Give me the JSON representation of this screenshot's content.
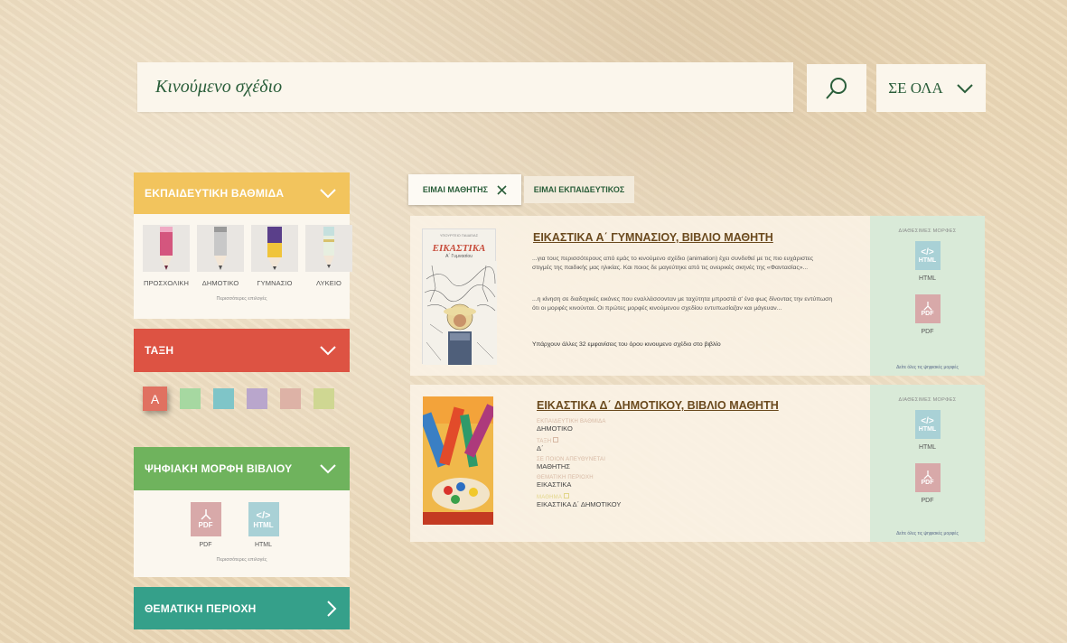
{
  "search": {
    "value": "Κινούμενο σχέδιο",
    "scope_label": "ΣΕ ΟΛΑ"
  },
  "colors": {
    "green_text": "#2a5e3a",
    "yellow": "#f2c45d",
    "red": "#dd5343",
    "green": "#6fb35d",
    "teal": "#35a08a"
  },
  "panels": {
    "education": {
      "title": "ΕΚΠΑΙΔΕΥΤΙΚΗ ΒΑΘΜΙΔΑ",
      "items": [
        {
          "label": "ΠΡΟΣΧΟΛΙΚΗ",
          "icon": "pink-pencil-icon"
        },
        {
          "label": "ΔΗΜΟΤΙΚΟ",
          "icon": "grey-pencil-icon"
        },
        {
          "label": "ΓΥΜΝΑΣΙΟ",
          "icon": "yellow-pencil-icon"
        },
        {
          "label": "ΛΥΚΕΙΟ",
          "icon": "light-pencil-icon"
        }
      ],
      "more": "Περισσότερες επιλογές"
    },
    "class": {
      "title": "ΤΑΞΗ",
      "first_label": "A",
      "swatches": [
        "#a6d8a1",
        "#7fc5c8",
        "#b9a6cc",
        "#ddb2a6",
        "#cfd792"
      ]
    },
    "digital": {
      "title": "ΨΗΦΙΑΚΗ ΜΟΡΦΗ ΒΙΒΛΙΟΥ",
      "formats": [
        {
          "label": "PDF",
          "icon": "pdf-icon"
        },
        {
          "label": "HTML",
          "icon": "html-icon"
        }
      ],
      "more": "Περισσότερες επιλογές"
    },
    "thematic": {
      "title": "ΘΕΜΑΤΙΚΗ ΠΕΡΙΟΧΗ"
    }
  },
  "tabs": {
    "student": "ΕΙΜΑΙ ΜΑΘΗΤΗΣ",
    "teacher": "ΕΙΜΑΙ ΕΚΠΑΙΔΕΥΤΙΚΟΣ"
  },
  "results": [
    {
      "title": "ΕΙΚΑΣΤΙΚΑ Α΄ ΓΥΜΝΑΣΙΟΥ, ΒΙΒΛΙΟ ΜΑΘΗΤΗ",
      "cover_title": "ΕΙΚΑΣΤΙΚΑ",
      "cover_sub": "Α΄ Γυμνασίου",
      "snippet1": "...για τους περισσότερους από εμάς το κινούμενο σχέδιο (animation) έχει συνδεθεί με τις πιο ευχάριστες στιγμές της παιδικής μας ηλικίας. Και ποιος δε μαγεύτηκε από τις ονειρικές σκηνές της «Φαντασίας»...",
      "snippet2": "...η κίνηση σε διαδοχικές εικόνες που εναλλάσσονταν με ταχύτητα μπροστά σ' ένα φως δίνοντας την εντύπωση ότι οι μορφές κινούνται. Οι πρώτες μορφές κινούμενου σχεδίου εντυπωσίαζαν και μάγευαν...",
      "occurrences": "Υπάρχουν άλλες 32 εμφανίσεις του όρου κινουμενο σχέδιο στο βιβλίο",
      "side_title": "ΔΙΑΘΕΣΙΜΕΣ ΜΟΡΦΕΣ",
      "formats": [
        "HTML",
        "PDF"
      ],
      "side_link": "Δείτε όλες τις ψηφιακές μορφές"
    },
    {
      "title": "ΕΙΚΑΣΤΙΚΑ Δ΄ ΔΗΜΟΤΙΚΟΥ, ΒΙΒΛΙΟ ΜΑΘΗΤΗ",
      "meta": [
        {
          "label": "ΕΚΠΑΙΔΕΥΤΙΚΗ ΒΑΘΜΙΔΑ",
          "value": "ΔΗΜΟΤΙΚΟ"
        },
        {
          "label": "ΤΑΞΗ",
          "value": "Δ΄"
        },
        {
          "label": "ΣΕ ΠΟΙΟΝ ΑΠΕΥΘΥΝΕΤΑΙ",
          "value": "ΜΑΘΗΤΗΣ"
        },
        {
          "label": "ΘΕΜΑΤΙΚΗ ΠΕΡΙΟΧΗ",
          "value": "ΕΙΚΑΣΤΙΚΑ"
        },
        {
          "label": "ΜΑΘΗΜΑ",
          "value": "ΕΙΚΑΣΤΙΚΑ Δ΄ ΔΗΜΟΤΙΚΟΥ"
        }
      ],
      "side_title": "ΔΙΑΘΕΣΙΜΕΣ ΜΟΡΦΕΣ",
      "formats": [
        "HTML",
        "PDF"
      ],
      "side_link": "Δείτε όλες τις ψηφιακές μορφές"
    }
  ]
}
